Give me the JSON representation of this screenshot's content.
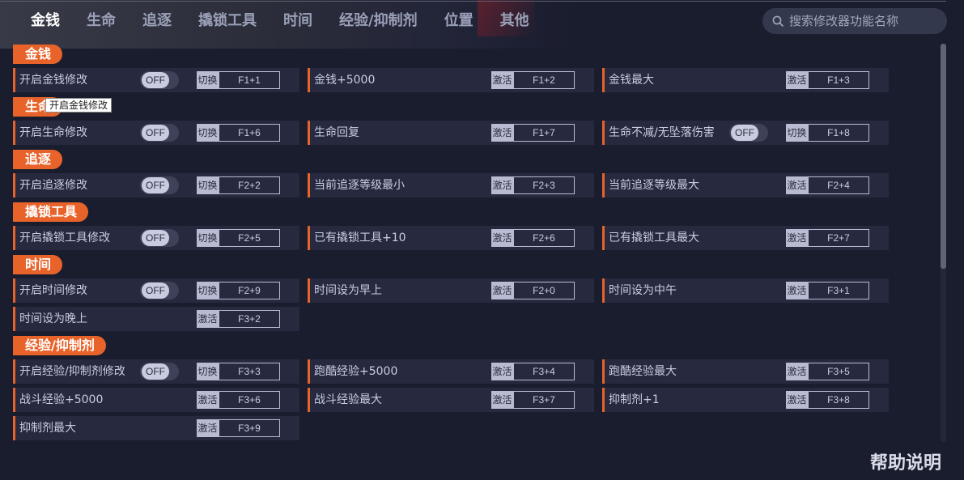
{
  "nav": {
    "tabs": [
      "金钱",
      "生命",
      "追逐",
      "撬锁工具",
      "时间",
      "经验/抑制剂",
      "位置",
      "其他"
    ],
    "active_index": 0
  },
  "search": {
    "placeholder": "搜索修改器功能名称"
  },
  "tooltip": "开启金钱修改",
  "help_label": "帮助说明",
  "colors": {
    "accent": "#e8632a",
    "background": "#1a1d2e",
    "cell": "#272a3f"
  },
  "sections": [
    {
      "title": "金钱",
      "rows": [
        [
          {
            "label": "开启金钱修改",
            "toggle": "OFF",
            "tag": "切换",
            "key": "F1+1"
          },
          {
            "label": "金钱+5000",
            "tag": "激活",
            "key": "F1+2"
          },
          {
            "label": "金钱最大",
            "tag": "激活",
            "key": "F1+3"
          }
        ]
      ]
    },
    {
      "title": "生命",
      "rows": [
        [
          {
            "label": "开启生命修改",
            "toggle": "OFF",
            "tag": "切换",
            "key": "F1+6"
          },
          {
            "label": "生命回复",
            "tag": "激活",
            "key": "F1+7"
          },
          {
            "label": "生命不减/无坠落伤害",
            "toggle": "OFF",
            "tag": "切换",
            "key": "F1+8"
          }
        ]
      ]
    },
    {
      "title": "追逐",
      "rows": [
        [
          {
            "label": "开启追逐修改",
            "toggle": "OFF",
            "tag": "切换",
            "key": "F2+2"
          },
          {
            "label": "当前追逐等级最小",
            "tag": "激活",
            "key": "F2+3"
          },
          {
            "label": "当前追逐等级最大",
            "tag": "激活",
            "key": "F2+4"
          }
        ]
      ]
    },
    {
      "title": "撬锁工具",
      "rows": [
        [
          {
            "label": "开启撬锁工具修改",
            "toggle": "OFF",
            "tag": "切换",
            "key": "F2+5"
          },
          {
            "label": "已有撬锁工具+10",
            "tag": "激活",
            "key": "F2+6"
          },
          {
            "label": "已有撬锁工具最大",
            "tag": "激活",
            "key": "F2+7"
          }
        ]
      ]
    },
    {
      "title": "时间",
      "rows": [
        [
          {
            "label": "开启时间修改",
            "toggle": "OFF",
            "tag": "切换",
            "key": "F2+9"
          },
          {
            "label": "时间设为早上",
            "tag": "激活",
            "key": "F2+0"
          },
          {
            "label": "时间设为中午",
            "tag": "激活",
            "key": "F3+1"
          }
        ],
        [
          {
            "label": "时间设为晚上",
            "tag": "激活",
            "key": "F3+2"
          }
        ]
      ]
    },
    {
      "title": "经验/抑制剂",
      "rows": [
        [
          {
            "label": "开启经验/抑制剂修改",
            "toggle": "OFF",
            "tag": "切换",
            "key": "F3+3"
          },
          {
            "label": "跑酷经验+5000",
            "tag": "激活",
            "key": "F3+4"
          },
          {
            "label": "跑酷经验最大",
            "tag": "激活",
            "key": "F3+5"
          }
        ],
        [
          {
            "label": "战斗经验+5000",
            "tag": "激活",
            "key": "F3+6"
          },
          {
            "label": "战斗经验最大",
            "tag": "激活",
            "key": "F3+7"
          },
          {
            "label": "抑制剂+1",
            "tag": "激活",
            "key": "F3+8"
          }
        ],
        [
          {
            "label": "抑制剂最大",
            "tag": "激活",
            "key": "F3+9"
          }
        ]
      ]
    }
  ]
}
